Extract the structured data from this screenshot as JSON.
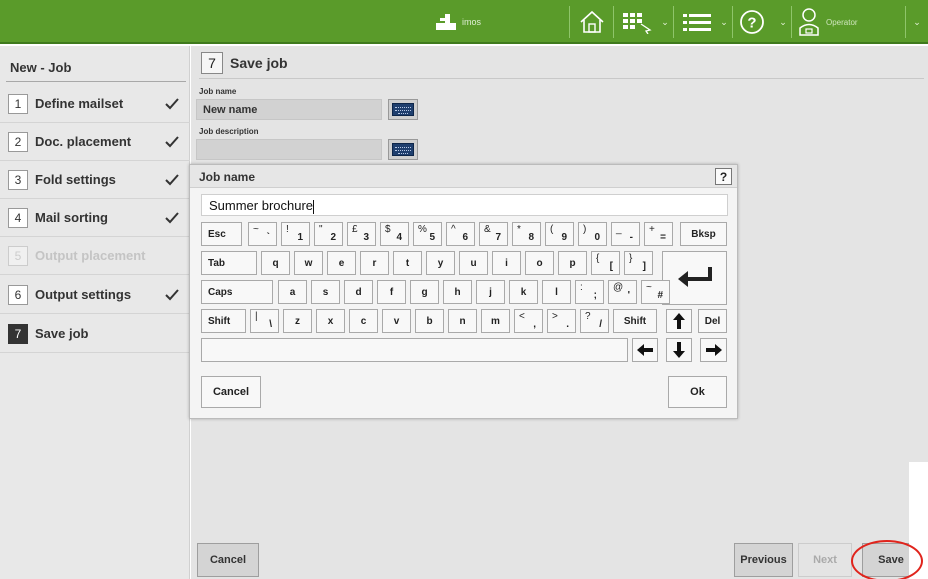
{
  "topbar": {
    "brand_text": "imos",
    "operator_label": "Operator",
    "icons": [
      "home-icon",
      "job-grid-icon",
      "menu-icon",
      "help-icon",
      "user-icon"
    ]
  },
  "sidebar": {
    "title": "New - Job",
    "steps": [
      {
        "num": "1",
        "label": "Define mailset",
        "done": true,
        "state": "normal"
      },
      {
        "num": "2",
        "label": "Doc. placement",
        "done": true,
        "state": "normal"
      },
      {
        "num": "3",
        "label": "Fold settings",
        "done": true,
        "state": "normal"
      },
      {
        "num": "4",
        "label": "Mail sorting",
        "done": true,
        "state": "normal"
      },
      {
        "num": "5",
        "label": "Output placement",
        "done": false,
        "state": "disabled"
      },
      {
        "num": "6",
        "label": "Output settings",
        "done": true,
        "state": "normal"
      },
      {
        "num": "7",
        "label": "Save job",
        "done": false,
        "state": "active"
      }
    ]
  },
  "main": {
    "page_num": "7",
    "page_title": "Save job",
    "job_name_label": "Job name",
    "job_name_value": "New name",
    "job_description_label": "Job description",
    "job_description_value": ""
  },
  "dialog": {
    "title": "Job name",
    "help": "?",
    "input_value": "Summer brochure",
    "keys": {
      "esc": "Esc",
      "bksp": "Bksp",
      "tab": "Tab",
      "caps": "Caps",
      "shift": "Shift",
      "del": "Del",
      "row1": [
        {
          "s": "~",
          "m": "`"
        },
        {
          "s": "!",
          "m": "1"
        },
        {
          "s": "\"",
          "m": "2"
        },
        {
          "s": "£",
          "m": "3"
        },
        {
          "s": "$",
          "m": "4"
        },
        {
          "s": "%",
          "m": "5"
        },
        {
          "s": "^",
          "m": "6"
        },
        {
          "s": "&",
          "m": "7"
        },
        {
          "s": "*",
          "m": "8"
        },
        {
          "s": "(",
          "m": "9"
        },
        {
          "s": ")",
          "m": "0"
        },
        {
          "s": "_",
          "m": "-"
        },
        {
          "s": "+",
          "m": "="
        }
      ],
      "row2": [
        "q",
        "w",
        "e",
        "r",
        "t",
        "y",
        "u",
        "i",
        "o",
        "p"
      ],
      "row2_sym": [
        {
          "s": "{",
          "m": "["
        },
        {
          "s": "}",
          "m": "]"
        }
      ],
      "row3": [
        "a",
        "s",
        "d",
        "f",
        "g",
        "h",
        "j",
        "k",
        "l"
      ],
      "row3_sym": [
        {
          "s": ":",
          "m": ";"
        },
        {
          "s": "@",
          "m": "'"
        },
        {
          "s": "~",
          "m": "#"
        }
      ],
      "row4_sym_left": {
        "s": "|",
        "m": "\\"
      },
      "row4": [
        "z",
        "x",
        "c",
        "v",
        "b",
        "n",
        "m"
      ],
      "row4_sym": [
        {
          "s": "<",
          "m": ","
        },
        {
          "s": ">",
          "m": "."
        },
        {
          "s": "?",
          "m": "/"
        }
      ]
    },
    "cancel": "Cancel",
    "ok": "Ok"
  },
  "footer": {
    "cancel": "Cancel",
    "previous": "Previous",
    "next": "Next",
    "save": "Save"
  },
  "colors": {
    "topbar": "#5a9b2a",
    "highlight_circle": "#e0241c",
    "keyboard_icon": "#1f3f6e"
  }
}
